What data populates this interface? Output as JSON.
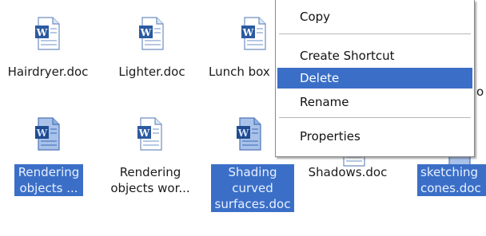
{
  "files": [
    {
      "name": "Hairdryer.doc",
      "selected": false
    },
    {
      "name": "Lighter.doc",
      "selected": false
    },
    {
      "name": "Lunch box",
      "selected": false
    },
    {
      "name": "Rendering objects ...",
      "selected": true
    },
    {
      "name": "Rendering objects wor...",
      "selected": false
    },
    {
      "name": "Shading curved surfaces.doc",
      "selected": true
    },
    {
      "name": "Shadows.doc",
      "selected": false
    },
    {
      "name": "sketching cones.doc",
      "selected": true
    }
  ],
  "labels": {
    "f0": "Hairdryer.doc",
    "f1": "Lighter.doc",
    "f2": "Lunch box",
    "f3_l1": "Rendering",
    "f3_l2": "objects ...",
    "f4_l1": "Rendering",
    "f4_l2": "objects wor...",
    "f5_l1": "Shading",
    "f5_l2": "curved",
    "f5_l3": "surfaces.doc",
    "f6": "Shadows.doc",
    "f7_l1": "sketching",
    "f7_l2": "cones.doc",
    "clipped_right": "o"
  },
  "context_menu": {
    "items": [
      "Copy",
      "Create Shortcut",
      "Delete",
      "Rename",
      "Properties"
    ],
    "active_item": "Delete"
  },
  "colors": {
    "selection": "#3b6fc7",
    "word_blue": "#2c5aa0"
  },
  "icons": {
    "document": "word-document-icon"
  }
}
